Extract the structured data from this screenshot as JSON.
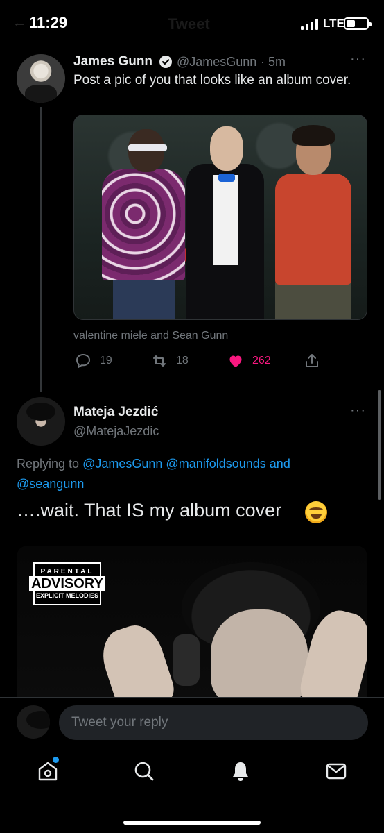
{
  "status_bar": {
    "time": "11:29",
    "network": "LTE"
  },
  "header": {
    "title": "Tweet"
  },
  "original_tweet": {
    "author_name": "James Gunn",
    "author_handle": "@JamesGunn",
    "time_ago": "· 5m",
    "text": "Post a pic of you that looks like an album cover.",
    "tagged": "valentine miele and Sean Gunn",
    "stats": {
      "replies": "19",
      "retweets": "18",
      "likes": "262"
    }
  },
  "reply_tweet": {
    "author_name": "Mateja Jezdić",
    "author_handle": "@MatejaJezdic",
    "replying_prefix": "Replying to",
    "mentions": [
      "@JamesGunn",
      "@manifoldsounds",
      "and",
      "@seangunn"
    ],
    "text": "….wait. That IS my album cover",
    "album_label": {
      "top": "PARENTAL",
      "middle": "ADVISORY",
      "bottom": "EXPLICIT MELODIES"
    }
  },
  "compose": {
    "placeholder": "Tweet your reply"
  },
  "tabs": [
    "home",
    "search",
    "notifications",
    "messages"
  ],
  "colors": {
    "background": "#000000",
    "accent": "#1d9bf0",
    "like": "#f91880",
    "muted": "#71767b"
  }
}
